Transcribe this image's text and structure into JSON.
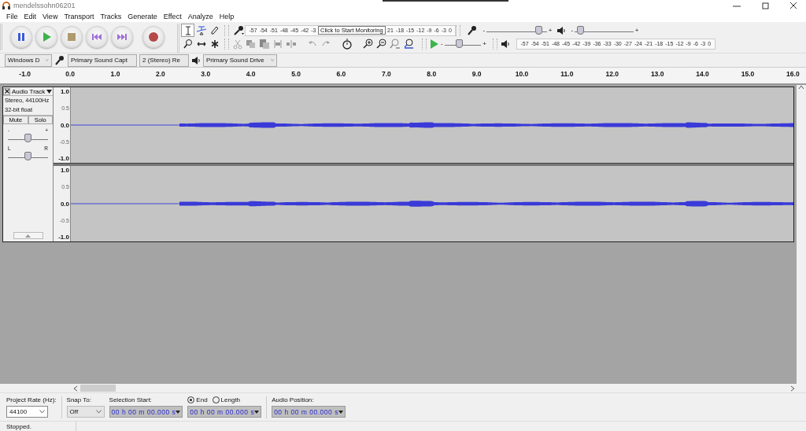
{
  "window": {
    "title": "mendelssohn06201"
  },
  "menu": [
    "File",
    "Edit",
    "View",
    "Transport",
    "Tracks",
    "Generate",
    "Effect",
    "Analyze",
    "Help"
  ],
  "tools": [
    {
      "kind": "select",
      "selected": true
    },
    {
      "kind": "envelope",
      "selected": false
    },
    {
      "kind": "draw",
      "selected": false
    },
    {
      "kind": "zoom",
      "selected": false
    },
    {
      "kind": "timeshift",
      "selected": false
    },
    {
      "kind": "multi",
      "selected": false
    }
  ],
  "record_meter": {
    "ticks_before": [
      "-57",
      "-54",
      "-51",
      "-48",
      "-45",
      "-42",
      "-3"
    ],
    "tooltip": "Click to Start Monitoring",
    "ticks_after": [
      "21",
      "-18",
      "-15",
      "-12",
      "-9",
      "-6",
      "-3",
      "0"
    ]
  },
  "mixer": {
    "record_volume": {
      "min_label": "-",
      "max_label": "+",
      "level": 0.92
    },
    "playback_volume": {
      "min_label": "-",
      "max_label": "+",
      "level": 0.04
    }
  },
  "play_at_speed": {
    "min_label": "-",
    "max_label": "+",
    "level": 0.38
  },
  "playback_meter": {
    "ticks": [
      "-57",
      "-54",
      "-51",
      "-48",
      "-45",
      "-42",
      "-39",
      "-36",
      "-33",
      "-30",
      "-27",
      "-24",
      "-21",
      "-18",
      "-15",
      "-12",
      "-9",
      "-6",
      "-3",
      "0"
    ]
  },
  "devices": {
    "host": "Windows D",
    "recording_device": "Primary Sound Capt",
    "channels": "2 (Stereo) Re",
    "playback_device": "Primary Sound Drive"
  },
  "ruler": {
    "labels": [
      "-1.0",
      "0.0",
      "1.0",
      "2.0",
      "3.0",
      "4.0",
      "5.0",
      "6.0",
      "7.0",
      "8.0",
      "9.0",
      "10.0",
      "11.0",
      "12.0",
      "13.0",
      "14.0",
      "15.0",
      "16.0"
    ]
  },
  "track": {
    "name": "Audio Track",
    "format": "Stereo, 44100Hz",
    "sample_format": "32-bit float",
    "buttons": [
      "Mute",
      "Solo"
    ],
    "gain": {
      "min_label": "-",
      "max_label": "+",
      "level": 0.5
    },
    "pan": {
      "min_label": "L",
      "max_label": "R",
      "level": 0.5
    },
    "channels": [
      {
        "scale": [
          "1.0",
          "0.5",
          "0.0",
          "-0.5",
          "-1.0"
        ]
      },
      {
        "scale": [
          "1.0",
          "0.5",
          "0.0",
          "-0.5",
          "-1.0"
        ]
      }
    ]
  },
  "selection_bar": {
    "project_rate_label": "Project Rate (Hz):",
    "project_rate": "44100",
    "snap_label": "Snap To:",
    "snap": "Off",
    "selection_start_label": "Selection Start:",
    "mode_options": [
      {
        "label": "End",
        "selected": true
      },
      {
        "label": "Length",
        "selected": false
      }
    ],
    "selection_start": "00 h 00 m 00.000 s",
    "selection_end": "00 h 00 m 00.000 s",
    "audio_position_label": "Audio Position:",
    "audio_position": "00 h 00 m 00.000 s"
  },
  "status_bar": {
    "text": "Stopped."
  }
}
